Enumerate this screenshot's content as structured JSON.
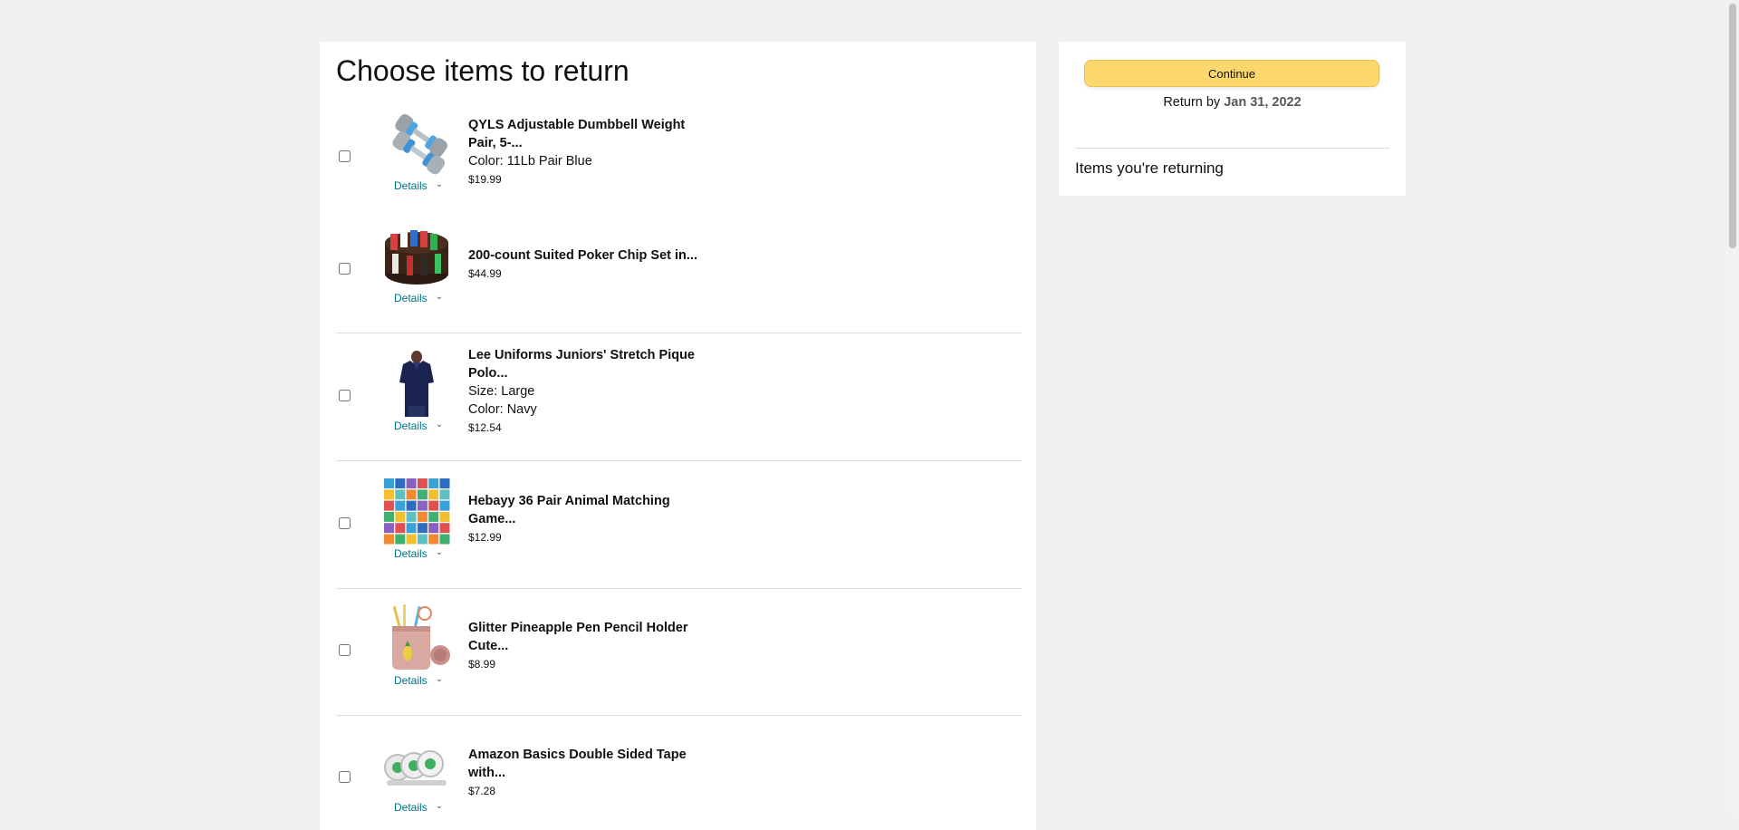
{
  "page": {
    "title": "Choose items to return"
  },
  "items": [
    {
      "title": "QYLS Adjustable Dumbbell Weight Pair, 5-...",
      "attributes": [
        "Color: 11Lb Pair Blue"
      ],
      "price": "$19.99",
      "details_label": "Details",
      "image_icon": "dumbbell-image"
    },
    {
      "title": "200-count Suited Poker Chip Set in...",
      "attributes": [],
      "price": "$44.99",
      "details_label": "Details",
      "image_icon": "poker-chips-image"
    },
    {
      "title": "Lee Uniforms Juniors' Stretch Pique Polo...",
      "attributes": [
        "Size: Large",
        "Color: Navy"
      ],
      "price": "$12.54",
      "details_label": "Details",
      "image_icon": "polo-shirt-image"
    },
    {
      "title": "Hebayy 36 Pair Animal Matching Game...",
      "attributes": [],
      "price": "$12.99",
      "details_label": "Details",
      "image_icon": "matching-game-image"
    },
    {
      "title": "Glitter Pineapple Pen Pencil Holder Cute...",
      "attributes": [],
      "price": "$8.99",
      "details_label": "Details",
      "image_icon": "pencil-holder-image"
    },
    {
      "title": "Amazon Basics Double Sided Tape with...",
      "attributes": [],
      "price": "$7.28",
      "details_label": "Details",
      "image_icon": "tape-image"
    }
  ],
  "sidebar": {
    "continue_label": "Continue",
    "return_by_prefix": "Return by",
    "return_by_date": "Jan 31, 2022",
    "returning_heading": "Items you're returning"
  },
  "colors": {
    "page_bg": "#f0f0f0",
    "button_bg": "#fcd86c",
    "link": "#007185"
  }
}
